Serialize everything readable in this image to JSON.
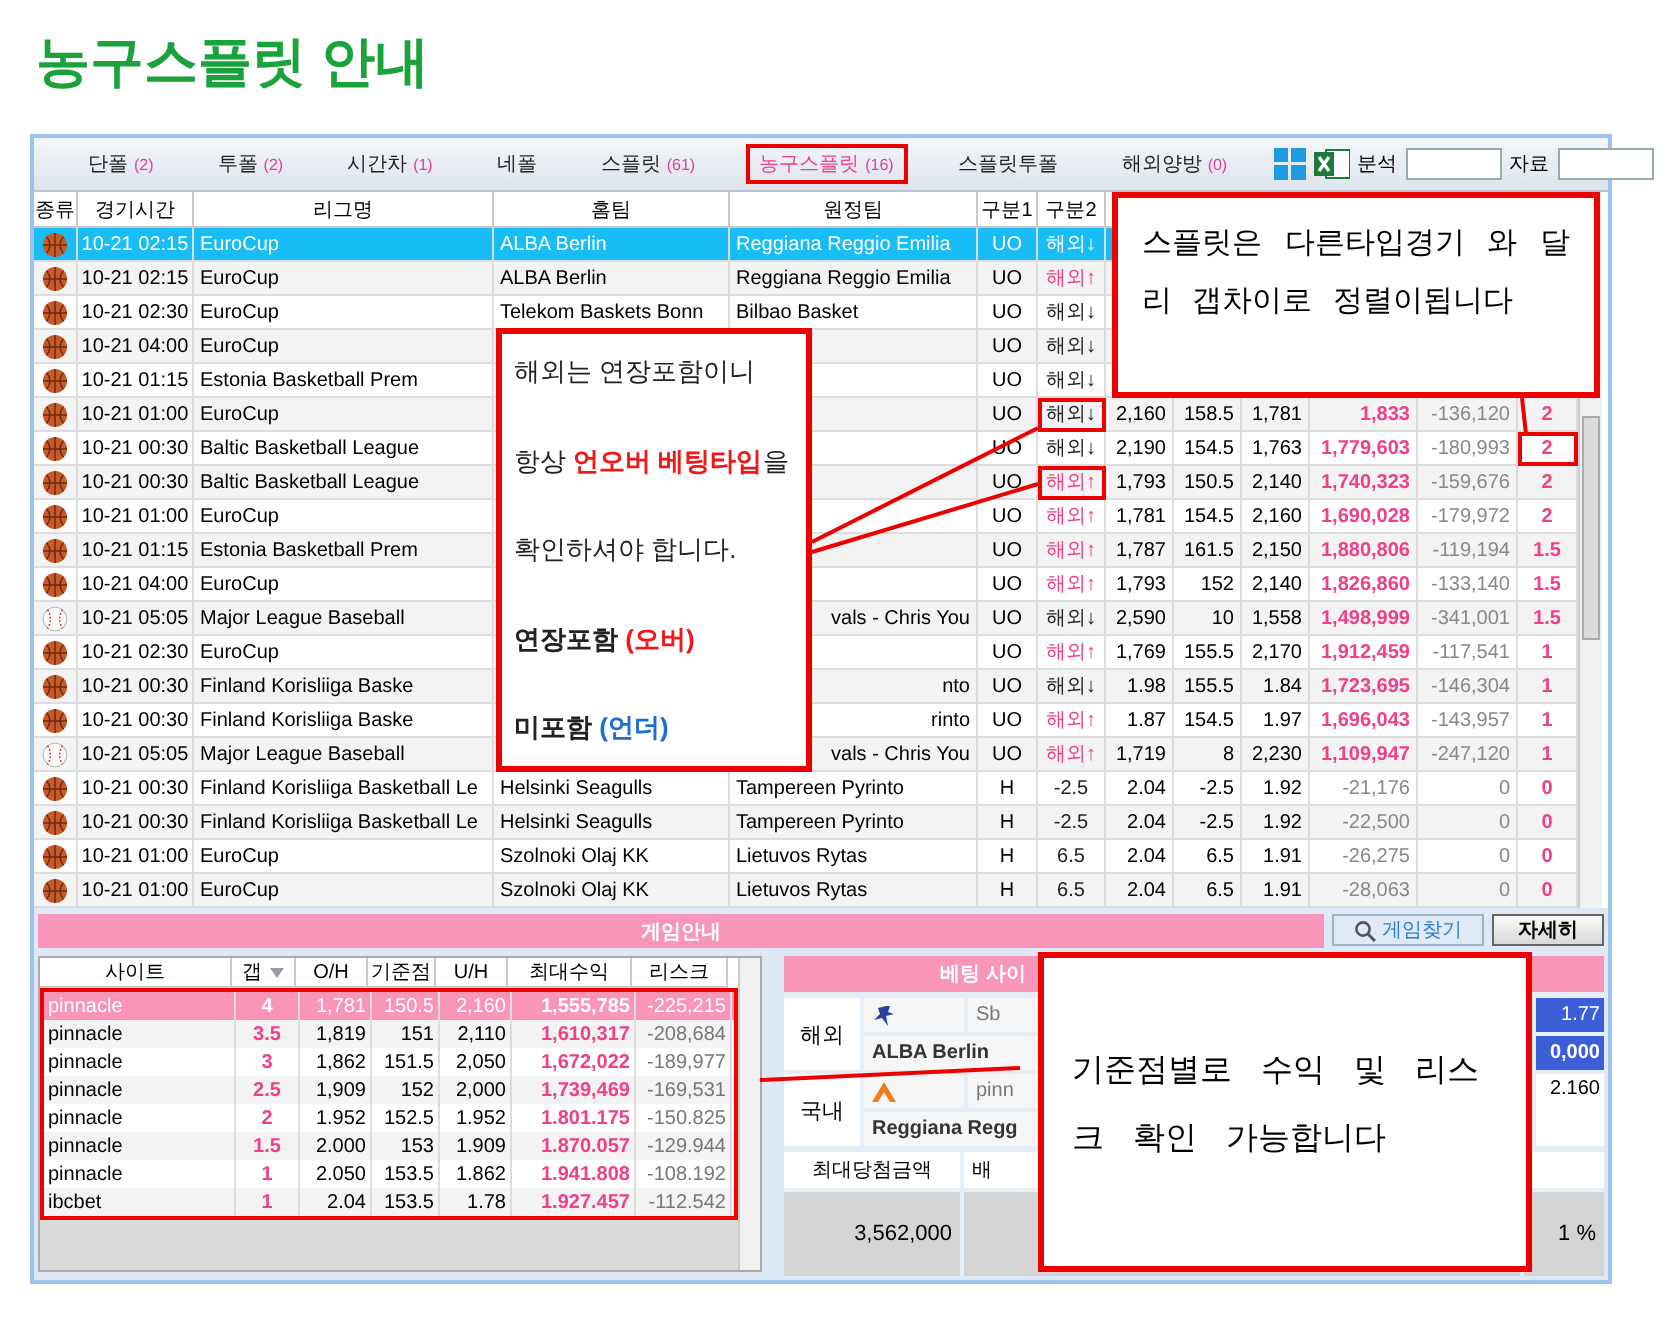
{
  "page_title": "농구스플릿 안내",
  "tabs": [
    {
      "label": "단폴",
      "count": "(2)",
      "selected": false
    },
    {
      "label": "투폴",
      "count": "(2)",
      "selected": false
    },
    {
      "label": "시간차",
      "count": "(1)",
      "selected": false
    },
    {
      "label": "네폴",
      "selected": false
    },
    {
      "label": "스플릿",
      "count": "(61)",
      "selected": false
    },
    {
      "label": "농구스플릿",
      "count": "(16)",
      "selected": true
    },
    {
      "label": "스플릿투폴",
      "selected": false
    },
    {
      "label": "해외양방",
      "count": "(0)",
      "selected": false
    }
  ],
  "toolbar_fields": [
    {
      "label": "분석"
    },
    {
      "label": "자료"
    }
  ],
  "match_table": {
    "columns": [
      "종류",
      "경기시간",
      "리그명",
      "홈팀",
      "원정팀",
      "구분1",
      "구분2"
    ],
    "rows": [
      {
        "sport_icon": {
          "kind": "basketball"
        },
        "time": "10-21 02:15",
        "league": "EuroCup",
        "home": "ALBA Berlin",
        "away": "Reggiana Reggio Emilia",
        "type": "UO",
        "kind": "uo",
        "split": {
          "text": "해외↓",
          "color": "#ffffff",
          "highlighted": false
        },
        "values": [],
        "selected": true
      },
      {
        "sport_icon": {
          "kind": "basketball"
        },
        "time": "10-21 02:15",
        "league": "EuroCup",
        "home": "ALBA Berlin",
        "away": "Reggiana Reggio Emilia",
        "type": "UO",
        "kind": "uo",
        "split": {
          "text": "해외↑",
          "color": "#f0408a",
          "highlighted": false
        },
        "values": [],
        "selected": false
      },
      {
        "sport_icon": {
          "kind": "basketball"
        },
        "time": "10-21 02:30",
        "league": "EuroCup",
        "home": "Telekom Baskets Bonn",
        "away": "Bilbao Basket",
        "type": "UO",
        "kind": "uo",
        "split": {
          "text": "해외↓",
          "color": "#222222",
          "highlighted": false
        },
        "values": [],
        "selected": false
      },
      {
        "sport_icon": {
          "kind": "basketball"
        },
        "time": "10-21 04:00",
        "league": "EuroCup",
        "type": "UO",
        "kind": "uo",
        "split": {
          "text": "해외↓",
          "color": "#222222",
          "highlighted": false
        },
        "values": [],
        "selected": false
      },
      {
        "sport_icon": {
          "kind": "basketball"
        },
        "time": "10-21 01:15",
        "league": "Estonia Basketball Prem",
        "type": "UO",
        "kind": "uo",
        "split": {
          "text": "해외↓",
          "color": "#222222",
          "highlighted": false
        },
        "values": [],
        "selected": false
      },
      {
        "sport_icon": {
          "kind": "basketball"
        },
        "time": "10-21 01:00",
        "league": "EuroCup",
        "type": "UO",
        "kind": "uo",
        "split": {
          "text": "해외↓",
          "color": "#222222",
          "highlighted": true
        },
        "values": [
          "2,160",
          "158.5",
          "1,781",
          "1,833",
          "-136,120",
          "2"
        ],
        "gap_highlighted": false,
        "selected": false
      },
      {
        "sport_icon": {
          "kind": "basketball"
        },
        "time": "10-21 00:30",
        "league": "Baltic Basketball League",
        "type": "UO",
        "kind": "uo",
        "split": {
          "text": "해외↓",
          "color": "#222222",
          "highlighted": false
        },
        "values": [
          "2,190",
          "154.5",
          "1,763",
          "1,779,603",
          "-180,993",
          "2"
        ],
        "gap_highlighted": true,
        "selected": false
      },
      {
        "sport_icon": {
          "kind": "basketball"
        },
        "time": "10-21 00:30",
        "league": "Baltic Basketball League",
        "type": "UO",
        "kind": "uo",
        "split": {
          "text": "해외↑",
          "color": "#f0408a",
          "highlighted": true
        },
        "values": [
          "1,793",
          "150.5",
          "2,140",
          "1,740,323",
          "-159,676",
          "2"
        ],
        "gap_highlighted": false,
        "selected": false
      },
      {
        "sport_icon": {
          "kind": "basketball"
        },
        "time": "10-21 01:00",
        "league": "EuroCup",
        "type": "UO",
        "kind": "uo",
        "split": {
          "text": "해외↑",
          "color": "#f0408a",
          "highlighted": false
        },
        "values": [
          "1,781",
          "154.5",
          "2,160",
          "1,690,028",
          "-179,972",
          "2"
        ],
        "gap_highlighted": false,
        "selected": false
      },
      {
        "sport_icon": {
          "kind": "basketball"
        },
        "time": "10-21 01:15",
        "league": "Estonia Basketball Prem",
        "type": "UO",
        "kind": "uo",
        "split": {
          "text": "해외↑",
          "color": "#f0408a",
          "highlighted": false
        },
        "values": [
          "1,787",
          "161.5",
          "2,150",
          "1,880,806",
          "-119,194",
          "1.5"
        ],
        "gap_highlighted": false,
        "selected": false
      },
      {
        "sport_icon": {
          "kind": "basketball"
        },
        "time": "10-21 04:00",
        "league": "EuroCup",
        "type": "UO",
        "kind": "uo",
        "split": {
          "text": "해외↑",
          "color": "#f0408a",
          "highlighted": false
        },
        "values": [
          "1,793",
          "152",
          "2,140",
          "1,826,860",
          "-133,140",
          "1.5"
        ],
        "gap_highlighted": false,
        "selected": false
      },
      {
        "sport_icon": {
          "kind": "baseball"
        },
        "time": "10-21 05:05",
        "league": "Major League Baseball",
        "away": "vals - Chris You",
        "type": "UO",
        "kind": "uo",
        "split": {
          "text": "해외↓",
          "color": "#222222",
          "highlighted": false
        },
        "values": [
          "2,590",
          "10",
          "1,558",
          "1,498,999",
          "-341,001",
          "1.5"
        ],
        "gap_highlighted": false,
        "selected": false
      },
      {
        "sport_icon": {
          "kind": "basketball"
        },
        "time": "10-21 02:30",
        "league": "EuroCup",
        "type": "UO",
        "kind": "uo",
        "split": {
          "text": "해외↑",
          "color": "#f0408a",
          "highlighted": false
        },
        "values": [
          "1,769",
          "155.5",
          "2,170",
          "1,912,459",
          "-117,541",
          "1"
        ],
        "gap_highlighted": false,
        "selected": false
      },
      {
        "sport_icon": {
          "kind": "basketball"
        },
        "time": "10-21 00:30",
        "league": "Finland Korisliiga Baske",
        "away": "nto",
        "type": "UO",
        "kind": "uo",
        "split": {
          "text": "해외↓",
          "color": "#222222",
          "highlighted": false
        },
        "values": [
          "1.98",
          "155.5",
          "1.84",
          "1,723,695",
          "-146,304",
          "1"
        ],
        "gap_highlighted": false,
        "selected": false
      },
      {
        "sport_icon": {
          "kind": "basketball"
        },
        "time": "10-21 00:30",
        "league": "Finland Korisliiga Baske",
        "away": "rinto",
        "type": "UO",
        "kind": "uo",
        "split": {
          "text": "해외↑",
          "color": "#f0408a",
          "highlighted": false
        },
        "values": [
          "1.87",
          "154.5",
          "1.97",
          "1,696,043",
          "-143,957",
          "1"
        ],
        "gap_highlighted": false,
        "selected": false
      },
      {
        "sport_icon": {
          "kind": "baseball"
        },
        "time": "10-21 05:05",
        "league": "Major League Baseball",
        "away": "vals - Chris You",
        "type": "UO",
        "kind": "uo",
        "split": {
          "text": "해외↑",
          "color": "#f0408a",
          "highlighted": false
        },
        "values": [
          "1,719",
          "8",
          "2,230",
          "1,109,947",
          "-247,120",
          "1"
        ],
        "gap_highlighted": false,
        "selected": false
      },
      {
        "sport_icon": {
          "kind": "basketball"
        },
        "time": "10-21 00:30",
        "league": "Finland Korisliiga Basketball Le",
        "home": "Helsinki Seagulls",
        "away": "Tampereen Pyrinto",
        "type": "H",
        "kind": "h",
        "split": {
          "text": "-2.5",
          "color": "#222222",
          "highlighted": false
        },
        "values": [
          "2.04",
          "-2.5",
          "1.92",
          "-21,176",
          "0",
          "0"
        ],
        "gap_highlighted": false,
        "selected": false
      },
      {
        "sport_icon": {
          "kind": "basketball"
        },
        "time": "10-21 00:30",
        "league": "Finland Korisliiga Basketball Le",
        "home": "Helsinki Seagulls",
        "away": "Tampereen Pyrinto",
        "type": "H",
        "kind": "h",
        "split": {
          "text": "-2.5",
          "color": "#222222",
          "highlighted": false
        },
        "values": [
          "2.04",
          "-2.5",
          "1.92",
          "-22,500",
          "0",
          "0"
        ],
        "gap_highlighted": false,
        "selected": false
      },
      {
        "sport_icon": {
          "kind": "basketball"
        },
        "time": "10-21 01:00",
        "league": "EuroCup",
        "home": "Szolnoki Olaj KK",
        "away": "Lietuvos Rytas",
        "type": "H",
        "kind": "h",
        "split": {
          "text": "6.5",
          "color": "#222222",
          "highlighted": false
        },
        "values": [
          "2.04",
          "6.5",
          "1.91",
          "-26,275",
          "0",
          "0"
        ],
        "gap_highlighted": false,
        "selected": false
      },
      {
        "sport_icon": {
          "kind": "basketball"
        },
        "time": "10-21 01:00",
        "league": "EuroCup",
        "home": "Szolnoki Olaj KK",
        "away": "Lietuvos Rytas",
        "type": "H",
        "kind": "h",
        "split": {
          "text": "6.5",
          "color": "#222222",
          "highlighted": false
        },
        "values": [
          "2.04",
          "6.5",
          "1.91",
          "-28,063",
          "0",
          "0"
        ],
        "gap_highlighted": false,
        "selected": false
      }
    ]
  },
  "callout_left": [
    [
      {
        "text": "해외는 연장포함이니",
        "bold": false,
        "color": "#222222"
      }
    ],
    [
      {
        "text": "항상 ",
        "bold": false,
        "color": "#222222"
      },
      {
        "text": "언오버 베팅타입",
        "bold": true,
        "color": "#f01818"
      },
      {
        "text": "을",
        "bold": false,
        "color": "#222222"
      }
    ],
    [
      {
        "text": "확인하셔야 합니다.",
        "bold": false,
        "color": "#222222"
      }
    ],
    [
      {
        "text": "연장포함 ",
        "bold": true,
        "color": "#222222"
      },
      {
        "text": "(오버)",
        "bold": true,
        "color": "#f01818"
      }
    ],
    [
      {
        "text": "미포함 ",
        "bold": true,
        "color": "#222222"
      },
      {
        "text": "(언더)",
        "bold": true,
        "color": "#1a6fd0"
      }
    ]
  ],
  "callout_right": "스플릿은 다른타입경기 와 달리 갭차이로 정렬이됩니다",
  "info_bar": {
    "title": "게임안내",
    "buttons": [
      {
        "label": "게임찾기",
        "kind": "search"
      },
      {
        "label": "자세히",
        "kind": "plain"
      }
    ]
  },
  "site_table": {
    "columns": [
      "사이트",
      "갭",
      "O/H",
      "기준점",
      "U/H",
      "최대수익",
      "리스크"
    ],
    "rows": [
      {
        "cells": [
          "pinnacle",
          "4",
          "1,781",
          "150.5",
          "2,160",
          "1,555,785",
          "-225,215"
        ],
        "selected": true
      },
      {
        "cells": [
          "pinnacle",
          "3.5",
          "1,819",
          "151",
          "2,110",
          "1,610,317",
          "-208,684"
        ],
        "selected": false
      },
      {
        "cells": [
          "pinnacle",
          "3",
          "1,862",
          "151.5",
          "2,050",
          "1,672,022",
          "-189,977"
        ],
        "selected": false
      },
      {
        "cells": [
          "pinnacle",
          "2.5",
          "1,909",
          "152",
          "2,000",
          "1,739,469",
          "-169,531"
        ],
        "selected": false
      },
      {
        "cells": [
          "pinnacle",
          "2",
          "1.952",
          "152.5",
          "1.952",
          "1.801.175",
          "-150.825"
        ],
        "selected": false
      },
      {
        "cells": [
          "pinnacle",
          "1.5",
          "2.000",
          "153",
          "1.909",
          "1.870.057",
          "-129.944"
        ],
        "selected": false
      },
      {
        "cells": [
          "pinnacle",
          "1",
          "2.050",
          "153.5",
          "1.862",
          "1.941.808",
          "-108.192"
        ],
        "selected": false
      },
      {
        "cells": [
          "ibcbet",
          "1",
          "2.04",
          "153.5",
          "1.78",
          "1.927.457",
          "-112.542"
        ],
        "selected": false
      }
    ]
  },
  "bet_panel": {
    "title": "베팅 사이",
    "overseas": {
      "label": "해외",
      "site": "Sb",
      "team": "ALBA Berlin",
      "odds": "1.77",
      "amount": "0,000"
    },
    "domestic": {
      "label": "국내",
      "site": "pinn",
      "team": "Reggiana Regg",
      "odds": "2.160"
    },
    "footer_labels": [
      "최대당첨금액",
      "배"
    ],
    "max_win": "3,562,000",
    "percent": "1 %"
  },
  "callout_bottom": "기준점별로 수익 및 리스크 확인 가능합니다"
}
